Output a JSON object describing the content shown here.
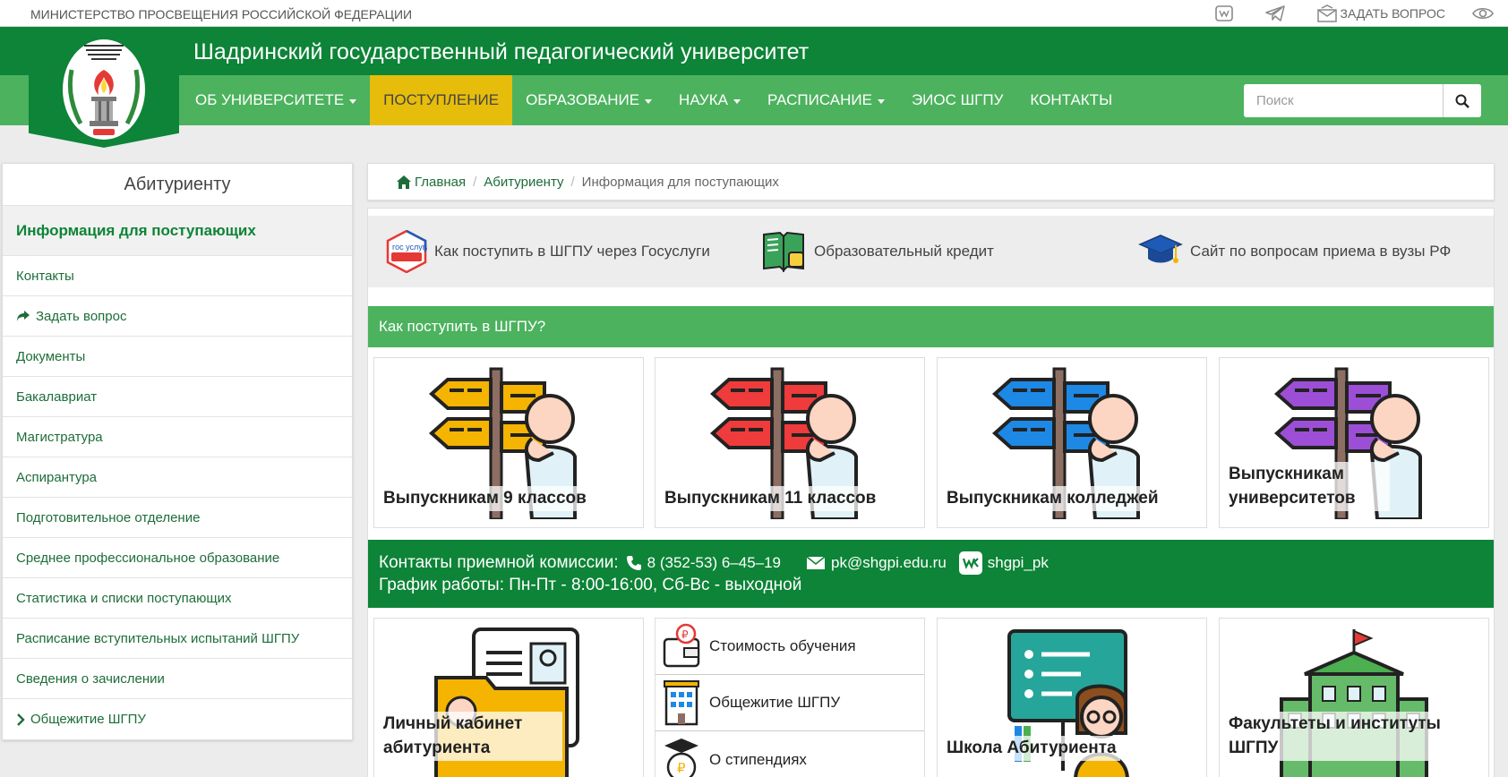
{
  "topbar": {
    "ministry": "МИНИСТЕРСТВО ПРОСВЕЩЕНИЯ РОССИЙСКОЙ ФЕДЕРАЦИИ",
    "ask_label": "ЗАДАТЬ ВОПРОС"
  },
  "header": {
    "title": "Шадринский государственный педагогический университет"
  },
  "nav": {
    "items": [
      {
        "label": "ОБ УНИВЕРСИТЕТЕ",
        "dropdown": true
      },
      {
        "label": "ПОСТУПЛЕНИЕ",
        "dropdown": false,
        "active": true
      },
      {
        "label": "ОБРАЗОВАНИЕ",
        "dropdown": true
      },
      {
        "label": "НАУКА",
        "dropdown": true
      },
      {
        "label": "РАСПИСАНИЕ",
        "dropdown": true
      },
      {
        "label": "ЭИОС ШГПУ",
        "dropdown": false
      },
      {
        "label": "КОНТАКТЫ",
        "dropdown": false
      }
    ],
    "search_placeholder": "Поиск"
  },
  "sidebar": {
    "title": "Абитуриенту",
    "current": "Информация для поступающих",
    "items": [
      {
        "label": "Контакты"
      },
      {
        "label": "Задать вопрос"
      },
      {
        "label": "Документы"
      },
      {
        "label": "Бакалавриат"
      },
      {
        "label": "Магистратура"
      },
      {
        "label": "Аспирантура"
      },
      {
        "label": "Подготовительное отделение"
      },
      {
        "label": "Среднее профессиональное образование"
      },
      {
        "label": "Статистика и списки поступающих"
      },
      {
        "label": "Расписание вступительных испытаний ШГПУ"
      },
      {
        "label": "Сведения о зачислении"
      },
      {
        "label": "Общежитие ШГПУ"
      }
    ]
  },
  "breadcrumb": {
    "home": "Главная",
    "parent": "Абитуриенту",
    "current": "Информация для поступающих"
  },
  "quick_links": [
    {
      "label": "Как поступить в ШГПУ через Госуслуги",
      "icon": "gosuslugi-icon",
      "icon_text": "гос услуги"
    },
    {
      "label": "Образовательный кредит",
      "icon": "book-icon"
    },
    {
      "label": "Сайт по вопросам приема в вузы РФ",
      "icon": "graduation-cap-icon"
    }
  ],
  "how_to": {
    "title": "Как поступить в ШГПУ?",
    "cards": [
      {
        "label": "Выпускникам 9 классов",
        "color": "#f4b400"
      },
      {
        "label": "Выпускникам 11 классов",
        "color": "#ef3b3b"
      },
      {
        "label": "Выпускникам колледжей",
        "color": "#1e88e5"
      },
      {
        "label": "Выпускникам университетов",
        "color": "#9c4fd6"
      }
    ]
  },
  "contacts": {
    "label": "Контакты приемной комиссии:",
    "phone": "8 (352-53) 6–45–19",
    "email": "pk@shgpi.edu.ru",
    "vk": "shgpi_pk",
    "schedule": "График работы: Пн-Пт - 8:00-16:00, Сб-Вс - выходной"
  },
  "bottom": {
    "cabinet": "Личный кабинет абитуриента",
    "list": [
      {
        "label": "Стоимость обучения",
        "icon": "wallet-icon"
      },
      {
        "label": "Общежитие ШГПУ",
        "icon": "dormitory-icon"
      },
      {
        "label": "О стипендиях",
        "icon": "scholarship-icon"
      }
    ],
    "school": "Школа Абитуриента",
    "faculties": "Факультеты и институты ШГПУ"
  }
}
